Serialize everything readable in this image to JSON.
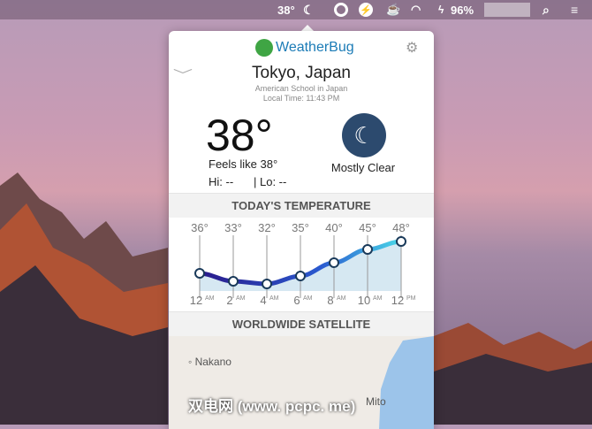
{
  "menubar": {
    "temperature": "38°",
    "battery": "96%",
    "icons": [
      "weather-moon-icon",
      "target-icon",
      "bolt-icon",
      "coffee-icon",
      "wifi-icon",
      "battery-charging-icon",
      "search-icon",
      "menu-icon"
    ]
  },
  "app": {
    "brand": "WeatherBug",
    "location": "Tokyo, Japan",
    "station": "American School in Japan",
    "local_time": "Local Time: 11:43 PM",
    "temperature": "38°",
    "feels_like": "Feels like 38°",
    "hi": "Hi: --",
    "lo": "| Lo: --",
    "condition": "Mostly Clear",
    "accent": "#2c4a6e"
  },
  "chart_data": {
    "type": "line",
    "title": "TODAY'S TEMPERATURE",
    "categories": [
      "12",
      "2",
      "4",
      "6",
      "8",
      "10",
      "12"
    ],
    "suffixes": [
      "AM",
      "AM",
      "AM",
      "AM",
      "AM",
      "AM",
      "PM"
    ],
    "values": [
      36,
      33,
      32,
      35,
      40,
      45,
      48
    ],
    "value_labels": [
      "36°",
      "33°",
      "32°",
      "35°",
      "40°",
      "45°",
      "48°"
    ]
  },
  "satellite": {
    "title": "WORLDWIDE SATELLITE",
    "places": [
      "Nakano",
      "Mito"
    ]
  },
  "watermark": "双电网 (www. pcpc. me)"
}
